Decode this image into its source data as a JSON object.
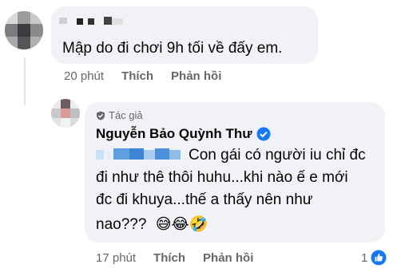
{
  "comment1": {
    "text": "Mập do đi chơi 9h tối về đấy em.",
    "time": "20 phút",
    "like": "Thích",
    "reply": "Phản hồi"
  },
  "comment2": {
    "author_badge": "Tác giả",
    "author_name": "Nguyễn Bảo Quỳnh Thư",
    "text_line1": "Con gái có người iu chỉ đc",
    "text_line2": "đi như thê thôi huhu...khi nào ế e mới",
    "text_line3": "đc đi khuya...thế a thấy nên như",
    "text_line4": "nao???",
    "emojis": "😅😂🤣",
    "time": "17 phút",
    "like": "Thích",
    "reply": "Phản hồi",
    "reaction_count": "1"
  },
  "colors": {
    "bubble": "#f0f2f5",
    "meta": "#65676b",
    "verified": "#1877f2"
  }
}
